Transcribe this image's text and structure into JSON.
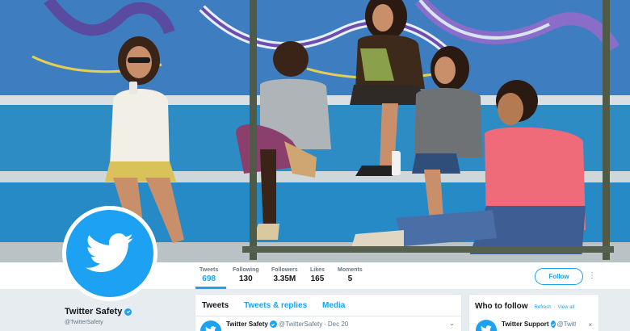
{
  "colors": {
    "brand": "#1da1f2",
    "text": "#14171a",
    "muted": "#657786",
    "border": "#e1e8ed",
    "background": "#e6ecf0"
  },
  "profile": {
    "name": "Twitter Safety",
    "handle": "@TwitterSafety",
    "avatar_icon": "twitter-bird-icon",
    "verified_icon": "verified-badge-icon"
  },
  "stats": [
    {
      "label": "Tweets",
      "value": "698",
      "active": true
    },
    {
      "label": "Following",
      "value": "130"
    },
    {
      "label": "Followers",
      "value": "3.35M"
    },
    {
      "label": "Likes",
      "value": "165"
    },
    {
      "label": "Moments",
      "value": "5"
    }
  ],
  "actions": {
    "follow_label": "Follow",
    "more_icon": "more-vertical-icon",
    "more_glyph": "⋮"
  },
  "timeline": {
    "tabs": [
      {
        "label": "Tweets",
        "active": true
      },
      {
        "label": "Tweets & replies"
      },
      {
        "label": "Media"
      }
    ],
    "tweet": {
      "name": "Twitter Safety",
      "handle": "@TwitterSafety",
      "separator": "·",
      "date": "Dec 20",
      "caret_icon": "chevron-down-icon",
      "caret_glyph": "⌄"
    }
  },
  "who_to_follow": {
    "title": "Who to follow",
    "separator": "·",
    "refresh_label": "Refresh",
    "view_all_label": "View all",
    "close_glyph": "×",
    "user": {
      "name": "Twitter Support",
      "handle": "@Twitt..."
    }
  }
}
